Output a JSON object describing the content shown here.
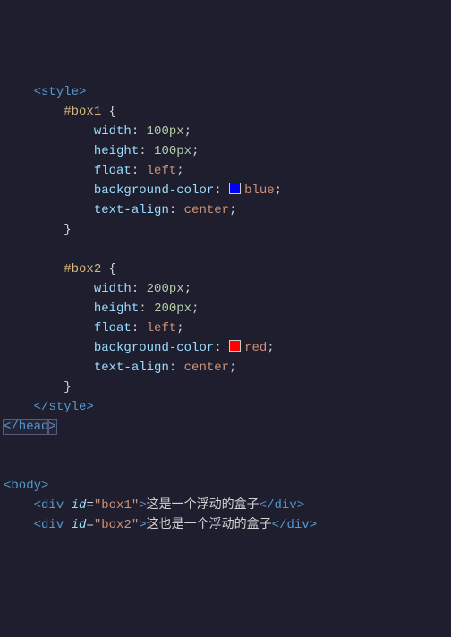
{
  "lines": {
    "l1": {
      "tag_open": "<style",
      "tag_close": ">"
    },
    "l2": {
      "selector": "#box1",
      "brace": "{"
    },
    "l3": {
      "prop": "width",
      "colon": ":",
      "val": "100",
      "unit": "px",
      "semi": ";"
    },
    "l4": {
      "prop": "height",
      "colon": ":",
      "val": "100",
      "unit": "px",
      "semi": ";"
    },
    "l5": {
      "prop": "float",
      "colon": ":",
      "val": "left",
      "semi": ";"
    },
    "l6": {
      "prop": "background-color",
      "colon": ":",
      "val": "blue",
      "semi": ";"
    },
    "l7": {
      "prop": "text-align",
      "colon": ":",
      "val": "center",
      "semi": ";"
    },
    "l8": {
      "brace": "}"
    },
    "l9": {
      "blank": ""
    },
    "l10": {
      "selector": "#box2",
      "brace": "{"
    },
    "l11": {
      "prop": "width",
      "colon": ":",
      "val": "200",
      "unit": "px",
      "semi": ";"
    },
    "l12": {
      "prop": "height",
      "colon": ":",
      "val": "200",
      "unit": "px",
      "semi": ";"
    },
    "l13": {
      "prop": "float",
      "colon": ":",
      "val": "left",
      "semi": ";"
    },
    "l14": {
      "prop": "background-color",
      "colon": ":",
      "val": "red",
      "semi": ";"
    },
    "l15": {
      "prop": "text-align",
      "colon": ":",
      "val": "center",
      "semi": ";"
    },
    "l16": {
      "brace": "}"
    },
    "l17": {
      "tag_open": "</style",
      "tag_close": ">"
    },
    "l18": {
      "tag_open": "</head",
      "tag_close": ">"
    },
    "l19": {
      "blank": ""
    },
    "l20": {
      "blank": ""
    },
    "l21": {
      "tag_open": "<body",
      "tag_close": ">"
    },
    "l22": {
      "open1": "<div ",
      "attr": "id",
      "eq": "=",
      "q1": "\"",
      "val": "box1",
      "q2": "\"",
      "open2": ">",
      "text": "这是一个浮动的盒子",
      "close1": "</div",
      "close2": ">"
    },
    "l23": {
      "open1": "<div ",
      "attr": "id",
      "eq": "=",
      "q1": "\"",
      "val": "box2",
      "q2": "\"",
      "open2": ">",
      "text": "这也是一个浮动的盒子",
      "close1": "</div",
      "close2": ">"
    }
  }
}
